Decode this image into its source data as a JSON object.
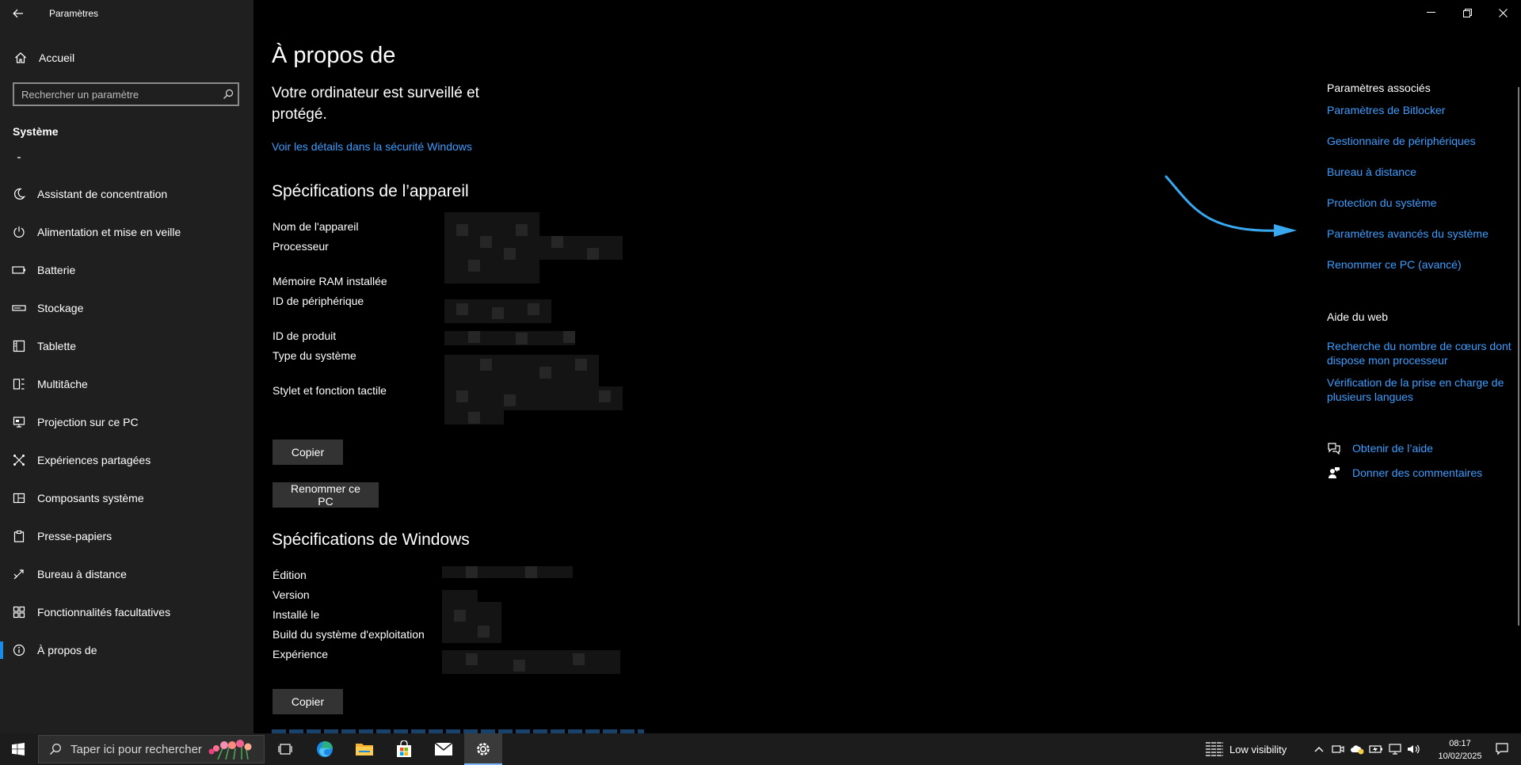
{
  "window": {
    "title": "Paramètres"
  },
  "sidebar": {
    "home_label": "Accueil",
    "search_placeholder": "Rechercher un paramètre",
    "section": "Système",
    "items": [
      {
        "label": "Assistant de concentration",
        "icon": "moon-icon"
      },
      {
        "label": "Alimentation et mise en veille",
        "icon": "power-icon"
      },
      {
        "label": "Batterie",
        "icon": "battery-icon"
      },
      {
        "label": "Stockage",
        "icon": "storage-icon"
      },
      {
        "label": "Tablette",
        "icon": "tablet-icon"
      },
      {
        "label": "Multitâche",
        "icon": "multitask-icon"
      },
      {
        "label": "Projection sur ce PC",
        "icon": "projection-icon"
      },
      {
        "label": "Expériences partagées",
        "icon": "shared-icon"
      },
      {
        "label": "Composants système",
        "icon": "components-icon"
      },
      {
        "label": "Presse-papiers",
        "icon": "clipboard-icon"
      },
      {
        "label": "Bureau à distance",
        "icon": "remote-icon"
      },
      {
        "label": "Fonctionnalités facultatives",
        "icon": "features-icon"
      },
      {
        "label": "À propos de",
        "icon": "info-icon",
        "active": true
      }
    ]
  },
  "main": {
    "title": "À propos de",
    "security_message": "Votre ordinateur est surveillé et protégé.",
    "security_link": "Voir les détails dans la sécurité Windows",
    "device_specs": {
      "heading": "Spécifications de l’appareil",
      "labels": [
        "Nom de l'appareil",
        "Processeur",
        "Mémoire RAM installée",
        "ID de périphérique",
        "ID de produit",
        "Type du système",
        "Stylet et fonction tactile"
      ],
      "copy_button": "Copier",
      "rename_button": "Renommer ce PC"
    },
    "windows_specs": {
      "heading": "Spécifications de Windows",
      "labels": [
        "Édition",
        "Version",
        "Installé le",
        "Build du système d'exploitation",
        "Expérience"
      ],
      "copy_button": "Copier"
    }
  },
  "right_panel": {
    "related_heading": "Paramètres associés",
    "related_links": [
      "Paramètres de Bitlocker",
      "Gestionnaire de périphériques",
      "Bureau à distance",
      "Protection du système",
      "Paramètres avancés du système",
      "Renommer ce PC (avancé)"
    ],
    "web_heading": "Aide du web",
    "web_links": [
      "Recherche du nombre de cœurs dont dispose mon processeur",
      "Vérification de la prise en charge de plusieurs langues"
    ],
    "help_links": [
      {
        "label": "Obtenir de l’aide",
        "icon": "help-chat-icon"
      },
      {
        "label": "Donner des commentaires",
        "icon": "feedback-icon"
      }
    ]
  },
  "taskbar": {
    "search_placeholder": "Taper ici pour rechercher",
    "apps": [
      "task-view-icon",
      "edge-icon",
      "file-explorer-icon",
      "store-icon",
      "mail-icon",
      "settings-icon"
    ],
    "weather": "Low visibility",
    "time": "08:17",
    "date": "10/02/2025"
  },
  "colors": {
    "accent": "#1a8ce8",
    "link": "#3d9eff",
    "sidebar_bg": "#1f1f1f",
    "content_bg": "#000000"
  }
}
